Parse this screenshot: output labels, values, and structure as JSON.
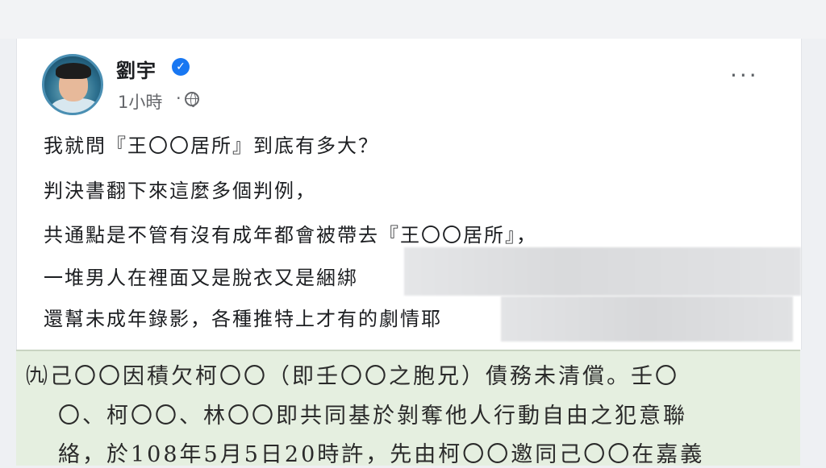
{
  "post": {
    "author": "劉宇",
    "time": "1小時",
    "dot": "·",
    "more": "···",
    "verified_mark": "✓",
    "lines": [
      "我就問『王〇〇居所』到底有多大？",
      "判決書翻下來這麼多個判例，",
      "共通點是不管有沒有成年都會被帶去『王〇〇居所』，",
      "一堆男人在裡面又是脫衣又是綑綁",
      "還幫未成年錄影，各種推特上才有的劇情耶"
    ]
  },
  "document": {
    "lines": [
      "㈨己〇〇因積欠柯〇〇（即壬〇〇之胞兄）債務未清償。壬〇",
      "〇、柯〇〇、林〇〇即共同基於剝奪他人行動自由之犯意聯",
      "絡，於108年5月5日20時許，先由柯〇〇邀同己〇〇在嘉義"
    ]
  },
  "icons": {
    "verified": "verified-badge-icon",
    "privacy": "globe-icon",
    "menu": "more-options-icon"
  },
  "colors": {
    "verified": "#1877f2",
    "doc_background": "#e5efe0"
  }
}
